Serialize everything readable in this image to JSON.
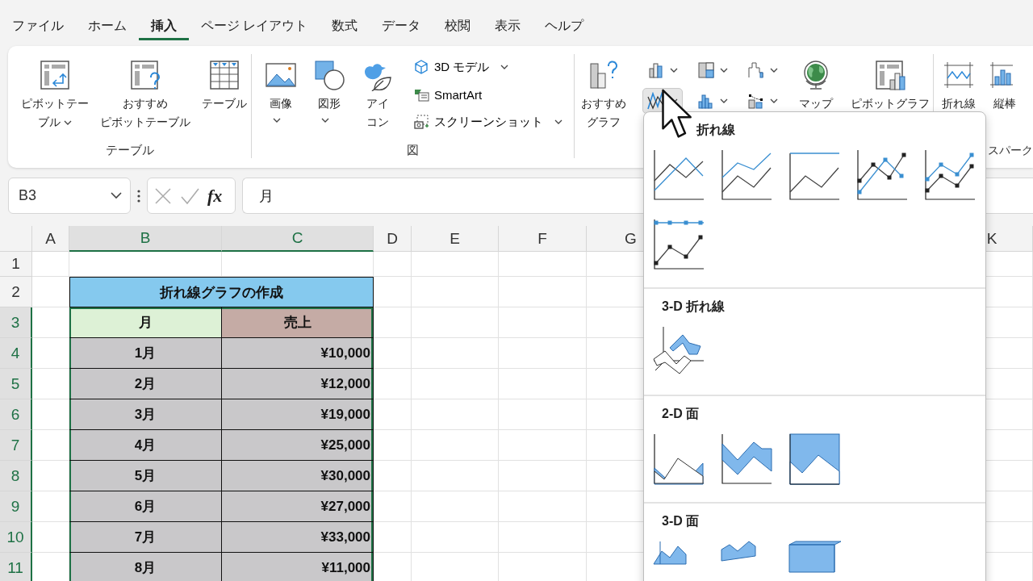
{
  "menu_tabs": [
    {
      "label": "ファイル",
      "selected": false
    },
    {
      "label": "ホーム",
      "selected": false
    },
    {
      "label": "挿入",
      "selected": true
    },
    {
      "label": "ページ レイアウト",
      "selected": false
    },
    {
      "label": "数式",
      "selected": false
    },
    {
      "label": "データ",
      "selected": false
    },
    {
      "label": "校閲",
      "selected": false
    },
    {
      "label": "表示",
      "selected": false
    },
    {
      "label": "ヘルプ",
      "selected": false
    }
  ],
  "ribbon": {
    "groups": [
      {
        "label": "テーブル",
        "items": [
          {
            "kind": "large",
            "label": [
              "ピボットテー",
              "ブル"
            ],
            "dropdown": true
          },
          {
            "kind": "large",
            "label": [
              "おすすめ",
              "ピボットテーブル"
            ],
            "dropdown": false
          },
          {
            "kind": "large",
            "label": "テーブル",
            "dropdown": false
          }
        ]
      },
      {
        "label": "図",
        "items": [
          {
            "kind": "large",
            "label": "画像",
            "dropdown": true
          },
          {
            "kind": "large",
            "label": "図形",
            "dropdown": true
          },
          {
            "kind": "large",
            "label": [
              "アイ",
              "コン"
            ],
            "dropdown": false
          },
          {
            "kind": "row",
            "label": "3D モデル",
            "dropdown": true
          },
          {
            "kind": "row",
            "label": "SmartArt",
            "dropdown": false
          },
          {
            "kind": "row",
            "label": "スクリーンショット",
            "dropdown": true
          }
        ]
      },
      {
        "items": [
          {
            "kind": "large",
            "label": [
              "おすすめ",
              "グラフ"
            ],
            "dropdown": false
          },
          {
            "kind": "icon",
            "dropdown": true,
            "pressed": false
          },
          {
            "kind": "icon",
            "dropdown": true,
            "pressed": false
          },
          {
            "kind": "icon",
            "dropdown": true,
            "pressed": false
          },
          {
            "kind": "icon",
            "dropdown": true,
            "pressed": true
          },
          {
            "kind": "icon",
            "dropdown": true,
            "pressed": false
          },
          {
            "kind": "icon",
            "dropdown": true,
            "pressed": false
          },
          {
            "kind": "large",
            "label": "マップ",
            "dropdown": false
          },
          {
            "kind": "large",
            "label": "ピボットグラフ",
            "dropdown": false
          }
        ]
      },
      {
        "label": "スパーク",
        "items": [
          {
            "kind": "large",
            "label": "折れ線",
            "dropdown": false
          },
          {
            "kind": "large",
            "label": "縦棒",
            "dropdown": false
          }
        ]
      }
    ]
  },
  "formula_bar": {
    "name_box": "B3",
    "function_button": "fx",
    "formula": "月"
  },
  "sheet": {
    "columns": [
      {
        "label": "A",
        "selected": false
      },
      {
        "label": "B",
        "selected": true
      },
      {
        "label": "C",
        "selected": true
      },
      {
        "label": "D",
        "selected": false
      },
      {
        "label": "E",
        "selected": false
      },
      {
        "label": "F",
        "selected": false
      },
      {
        "label": "G",
        "selected": false
      },
      {
        "label": "K",
        "selected": false
      }
    ],
    "rows": [
      {
        "label": "1",
        "selected": false
      },
      {
        "label": "2",
        "selected": false
      },
      {
        "label": "3",
        "selected": true
      },
      {
        "label": "4",
        "selected": true
      },
      {
        "label": "5",
        "selected": true
      },
      {
        "label": "6",
        "selected": true
      },
      {
        "label": "7",
        "selected": true
      },
      {
        "label": "8",
        "selected": true
      },
      {
        "label": "9",
        "selected": true
      },
      {
        "label": "10",
        "selected": true
      },
      {
        "label": "11",
        "selected": true
      }
    ],
    "table": {
      "title": "折れ線グラフの作成",
      "header": [
        {
          "text": "月",
          "color": "#ddf1d6"
        },
        {
          "text": "売上",
          "color": "#c5aba5"
        }
      ],
      "rows": [
        [
          "1月",
          "¥10,000"
        ],
        [
          "2月",
          "¥12,000"
        ],
        [
          "3月",
          "¥19,000"
        ],
        [
          "4月",
          "¥25,000"
        ],
        [
          "5月",
          "¥30,000"
        ],
        [
          "6月",
          "¥27,000"
        ],
        [
          "7月",
          "¥33,000"
        ],
        [
          "8月",
          "¥11,000"
        ]
      ]
    }
  },
  "chart_menu": {
    "sections": [
      {
        "title": "折れ線"
      },
      {
        "title": "3-D 折れ線"
      },
      {
        "title": "2-D 面"
      },
      {
        "title": "3-D 面"
      }
    ]
  }
}
